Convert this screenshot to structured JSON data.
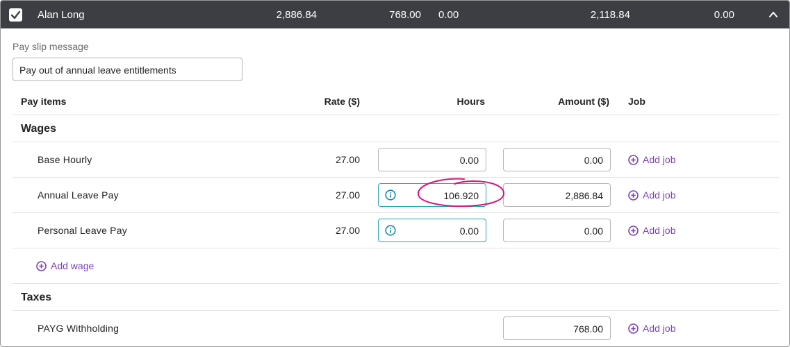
{
  "header": {
    "employee_name": "Alan Long",
    "value_1": "2,886.84",
    "value_2": "768.00",
    "value_3": "0.00",
    "value_4": "2,118.84",
    "value_5": "0.00"
  },
  "payslip": {
    "label": "Pay slip message",
    "value": "Pay out of annual leave entitlements"
  },
  "table": {
    "headers": {
      "pay_items": "Pay items",
      "rate": "Rate ($)",
      "hours": "Hours",
      "amount": "Amount ($)",
      "job": "Job"
    },
    "wages_title": "Wages",
    "wages": [
      {
        "label": "Base Hourly",
        "rate": "27.00",
        "hours": "0.00",
        "amount": "0.00",
        "add_job": "Add job"
      },
      {
        "label": "Annual Leave Pay",
        "rate": "27.00",
        "hours": "106.920",
        "amount": "2,886.84",
        "add_job": "Add job"
      },
      {
        "label": "Personal Leave Pay",
        "rate": "27.00",
        "hours": "0.00",
        "amount": "0.00",
        "add_job": "Add job"
      }
    ],
    "add_wage": "Add wage",
    "taxes_title": "Taxes",
    "taxes": [
      {
        "label": "PAYG Withholding",
        "amount": "768.00",
        "add_job": "Add job"
      }
    ]
  },
  "colors": {
    "header_bg": "#3c3e44",
    "link": "#7a3fbf",
    "info": "#1fa3b5",
    "annotation": "#d4157f"
  },
  "icons": {
    "checkbox": "checkbox-checked-icon",
    "collapse": "chevron-up-icon",
    "info": "info-icon",
    "add": "plus-circle-icon"
  }
}
